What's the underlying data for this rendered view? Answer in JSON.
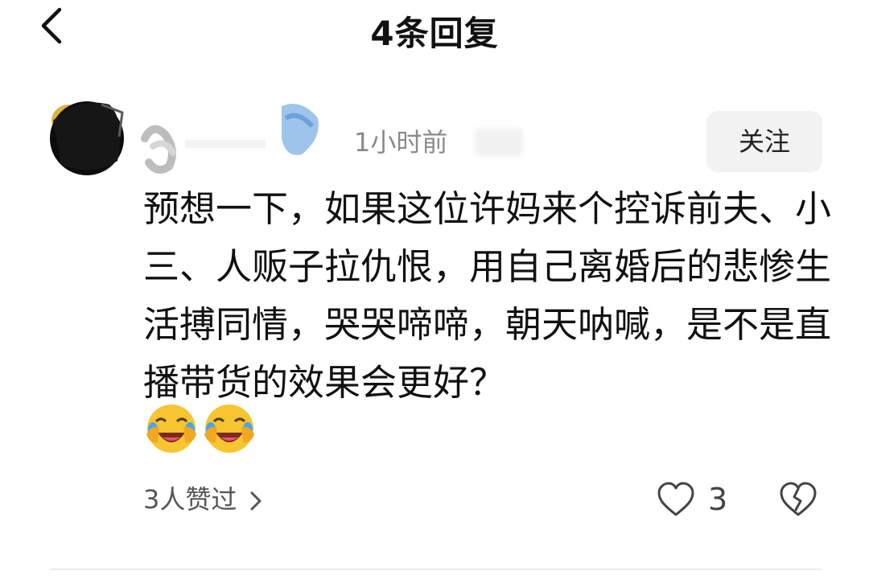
{
  "header": {
    "title": "4条回复",
    "back_icon": "chevron-left-icon"
  },
  "comment": {
    "timestamp": "1小时前",
    "follow_label": "关注",
    "text": "预想一下，如果这位许妈来个控诉前夫、小三、人贩子拉仇恨，用自己离婚后的悲惨生活搏同情，哭哭啼啼，朝天呐喊，是不是直播带货的效果会更好？",
    "emojis": [
      "laughing-crying-emoji",
      "laughing-crying-emoji"
    ],
    "likers_label": "3人赞过",
    "like_count": "3",
    "like_icon": "heart-outline-icon",
    "dislike_icon": "broken-heart-icon"
  },
  "colors": {
    "follow_bg": "#f2f2f2",
    "timestamp": "#8a8a8a",
    "emoji_yellow": "#f7c531"
  }
}
